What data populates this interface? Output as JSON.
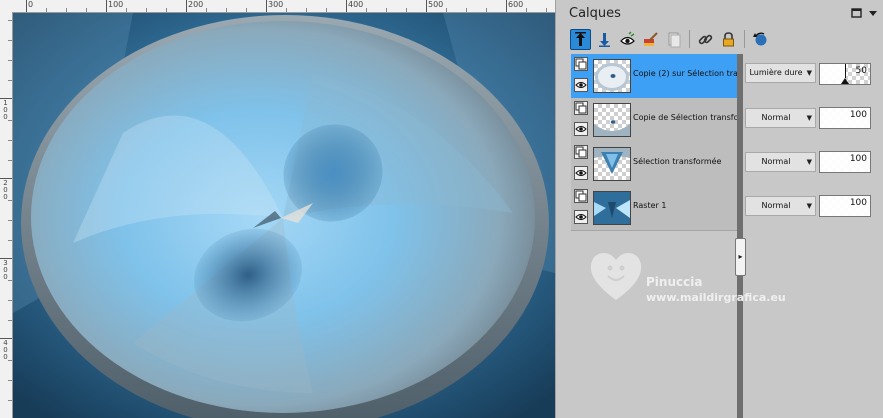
{
  "ruler": {
    "top_labels": [
      "0",
      "100",
      "200",
      "300",
      "400",
      "500",
      "600"
    ],
    "left_labels": [
      "1\n0\n0",
      "2\n0\n0",
      "3\n0\n0",
      "4\n0\n0"
    ]
  },
  "canvas": {
    "description_colors": {
      "center": "#86c6ec",
      "edge": "#8f9ea7",
      "dark": "#1f4664"
    }
  },
  "panel": {
    "title": "Calques",
    "maximize_icon": "square-icon",
    "menu_icon": "triangle-down-icon"
  },
  "toolbar": {
    "items": [
      "move-up-icon",
      "move-down-icon",
      "visibility-eye-icon",
      "paint-brush-icon",
      "document-icon",
      "link-chain-icon",
      "lock-icon",
      "rotate-reset-icon"
    ]
  },
  "layers": [
    {
      "name": "Copie (2) sur Sélection trar",
      "blend_mode": "Lumière dure",
      "opacity": 50,
      "selected": true
    },
    {
      "name": "Copie de Sélection transfo",
      "blend_mode": "Normal",
      "opacity": 100,
      "selected": false
    },
    {
      "name": "Sélection transformée",
      "blend_mode": "Normal",
      "opacity": 100,
      "selected": false
    },
    {
      "name": "Raster 1",
      "blend_mode": "Normal",
      "opacity": 100,
      "selected": false
    }
  ],
  "watermark": {
    "name": "Pinuccia",
    "url": "www.maildirgrafica.eu"
  },
  "colors": {
    "selection": "#3ea0f5",
    "active_button": "#2a8ad8"
  }
}
